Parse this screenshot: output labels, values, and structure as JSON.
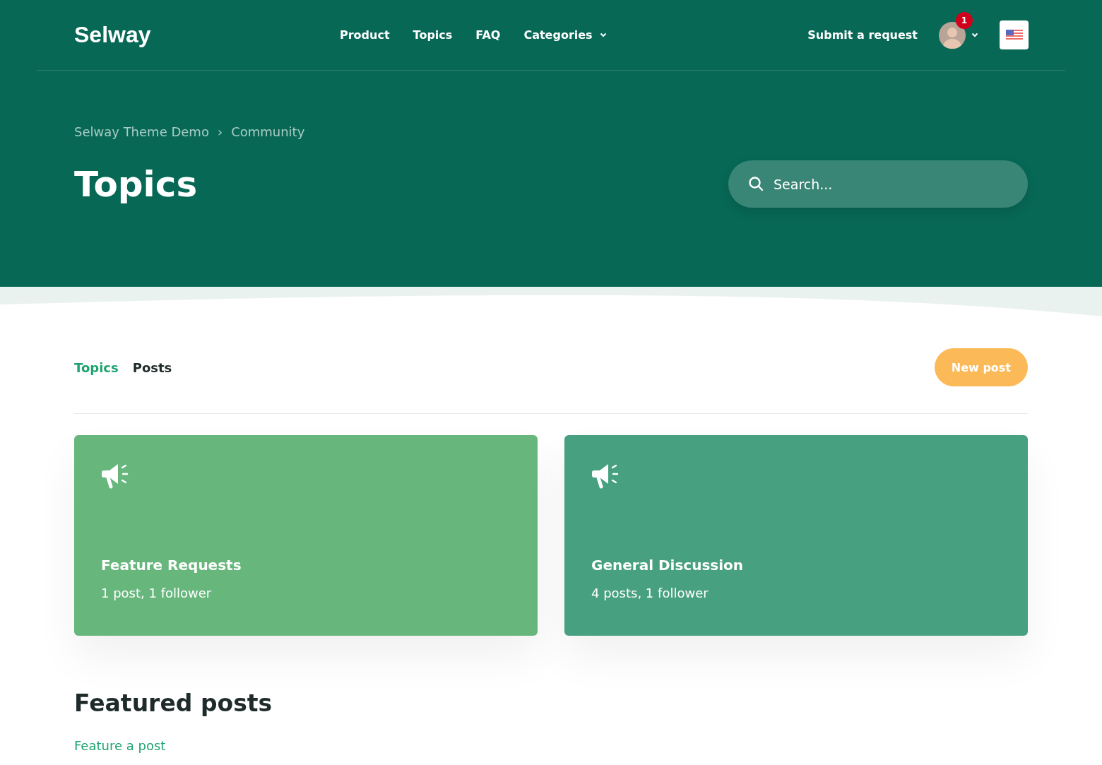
{
  "header": {
    "logo": "Selway",
    "nav": [
      {
        "label": "Product",
        "dropdown": false
      },
      {
        "label": "Topics",
        "dropdown": false
      },
      {
        "label": "FAQ",
        "dropdown": false
      },
      {
        "label": "Categories",
        "dropdown": true
      }
    ],
    "submit": "Submit a request",
    "notification_count": "1"
  },
  "breadcrumbs": [
    "Selway Theme Demo",
    "Community"
  ],
  "breadcrumb_separator": "›",
  "title": "Topics",
  "search": {
    "placeholder": "Search..."
  },
  "tabs": [
    {
      "label": "Topics",
      "selected": true
    },
    {
      "label": "Posts",
      "selected": false
    }
  ],
  "new_post": "New post",
  "topics": [
    {
      "name": "Feature Requests",
      "meta": "1 post, 1 follower",
      "color": "#67b77d"
    },
    {
      "name": "General Discussion",
      "meta": "4 posts, 1 follower",
      "color": "#47a07f"
    }
  ],
  "featured": {
    "heading": "Featured posts",
    "link": "Feature a post"
  }
}
